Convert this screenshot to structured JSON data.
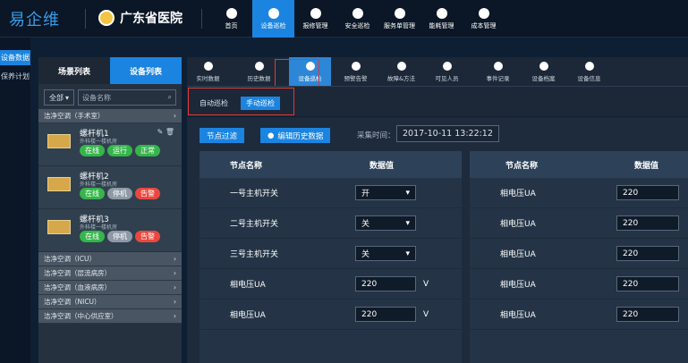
{
  "brand": "易企维",
  "hospital": "广东省医院",
  "topnav": [
    "首页",
    "设备巡检",
    "报修管理",
    "安全巡检",
    "服务单管理",
    "能耗管理",
    "成本管理"
  ],
  "topnav_active": "设备巡检",
  "leftnav": [
    "设备数据",
    "保养计划"
  ],
  "panel": {
    "tabs": [
      "场景列表",
      "设备列表"
    ],
    "filter": "全部",
    "search_placeholder": "设备名称",
    "group_open": "洁净空调（手术室）",
    "devices": [
      {
        "name": "螺杆机1",
        "sub": "外科楼一楼机房",
        "tags": [
          "在线",
          "运行",
          "正常"
        ]
      },
      {
        "name": "螺杆机2",
        "sub": "外科楼一楼机房",
        "tags": [
          "在线",
          "停机",
          "告警"
        ]
      },
      {
        "name": "螺杆机3",
        "sub": "外科楼一楼机房",
        "tags": [
          "在线",
          "停机",
          "告警"
        ]
      }
    ],
    "groups": [
      "洁净空调（ICU）",
      "洁净空调（层流病房）",
      "洁净空调（血液病房）",
      "洁净空调（NICU）",
      "洁净空调（中心供应室）"
    ]
  },
  "sec_tabs": [
    "实时数据",
    "历史数据",
    "设备巡检",
    "预警告警",
    "故障&方法",
    "可见人员",
    "事件记录",
    "设备档案",
    "设备信息"
  ],
  "sub_tabs": [
    "自动巡检",
    "手动巡检"
  ],
  "toolbar": {
    "filter": "节点过滤",
    "edit": "编辑历史数据",
    "collect_label": "采集时间：",
    "collect_time": "2017-10-11  13:22:12"
  },
  "table": {
    "headers": [
      "节点名称",
      "数据值"
    ],
    "left_rows": [
      {
        "name": "一号主机开关",
        "value": "开",
        "unit": "",
        "type": "select"
      },
      {
        "name": "二号主机开关",
        "value": "关",
        "unit": "",
        "type": "select"
      },
      {
        "name": "三号主机开关",
        "value": "关",
        "unit": "",
        "type": "select"
      },
      {
        "name": "相电压UA",
        "value": "220",
        "unit": "V",
        "type": "input"
      },
      {
        "name": "相电压UA",
        "value": "220",
        "unit": "V",
        "type": "input"
      }
    ],
    "right_rows": [
      {
        "name": "相电压UA",
        "value": "220"
      },
      {
        "name": "相电压UA",
        "value": "220"
      },
      {
        "name": "相电压UA",
        "value": "220"
      },
      {
        "name": "相电压UA",
        "value": "220"
      },
      {
        "name": "相电压UA",
        "value": "220"
      }
    ]
  }
}
